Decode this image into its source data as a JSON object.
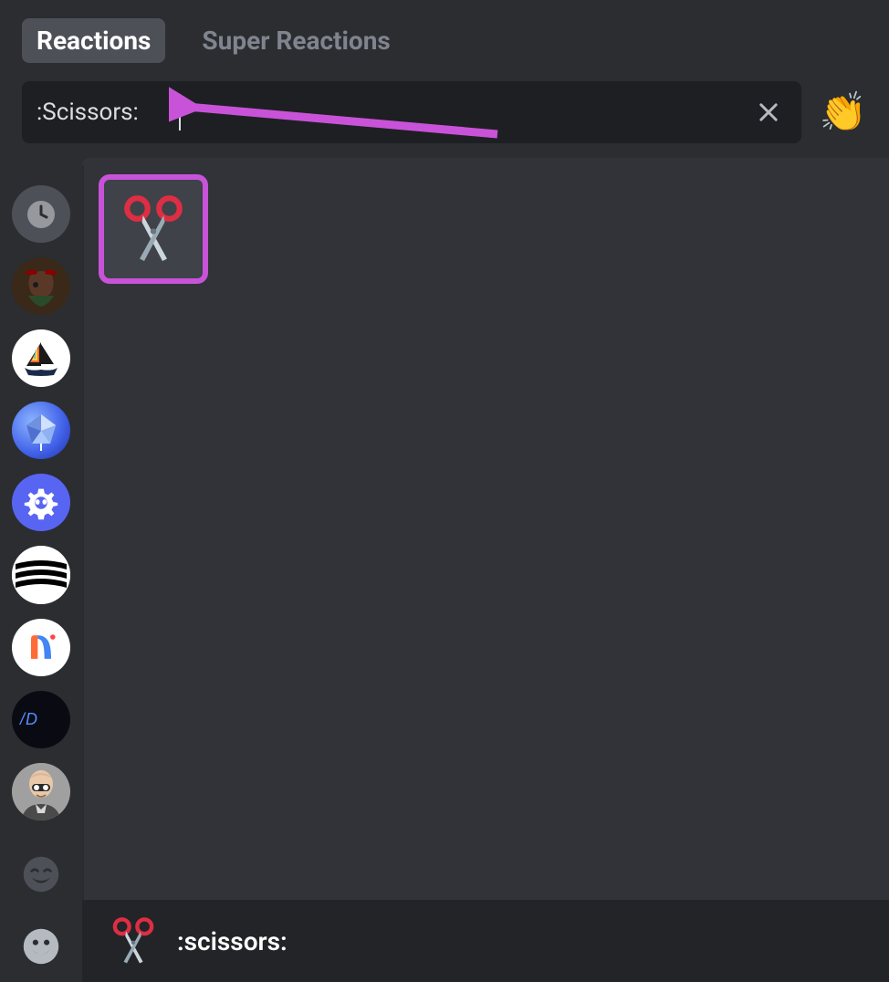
{
  "tabs": {
    "reactions": "Reactions",
    "super_reactions": "Super Reactions"
  },
  "search": {
    "value": ":Scissors:",
    "placeholder": ""
  },
  "skin_tone_emoji": "👏",
  "result": {
    "emoji_name": "scissors"
  },
  "footer": {
    "label": ":scissors:"
  },
  "colors": {
    "highlight": "#c853d9",
    "bg_dark": "#1e1f22",
    "bg_main": "#313338"
  },
  "sidebar": {
    "items": [
      {
        "name": "recent",
        "icon": "clock"
      },
      {
        "name": "server-1",
        "icon": "avatar"
      },
      {
        "name": "server-2",
        "icon": "sailboat"
      },
      {
        "name": "server-3",
        "icon": "gem"
      },
      {
        "name": "server-4",
        "icon": "discord-gear"
      },
      {
        "name": "server-5",
        "icon": "stripes"
      },
      {
        "name": "server-6",
        "icon": "n-logo"
      },
      {
        "name": "server-7",
        "icon": "ad-logo"
      },
      {
        "name": "server-8",
        "icon": "person"
      },
      {
        "name": "category-laugh",
        "icon": "laugh-face"
      },
      {
        "name": "category-smile",
        "icon": "smile-face"
      }
    ]
  }
}
